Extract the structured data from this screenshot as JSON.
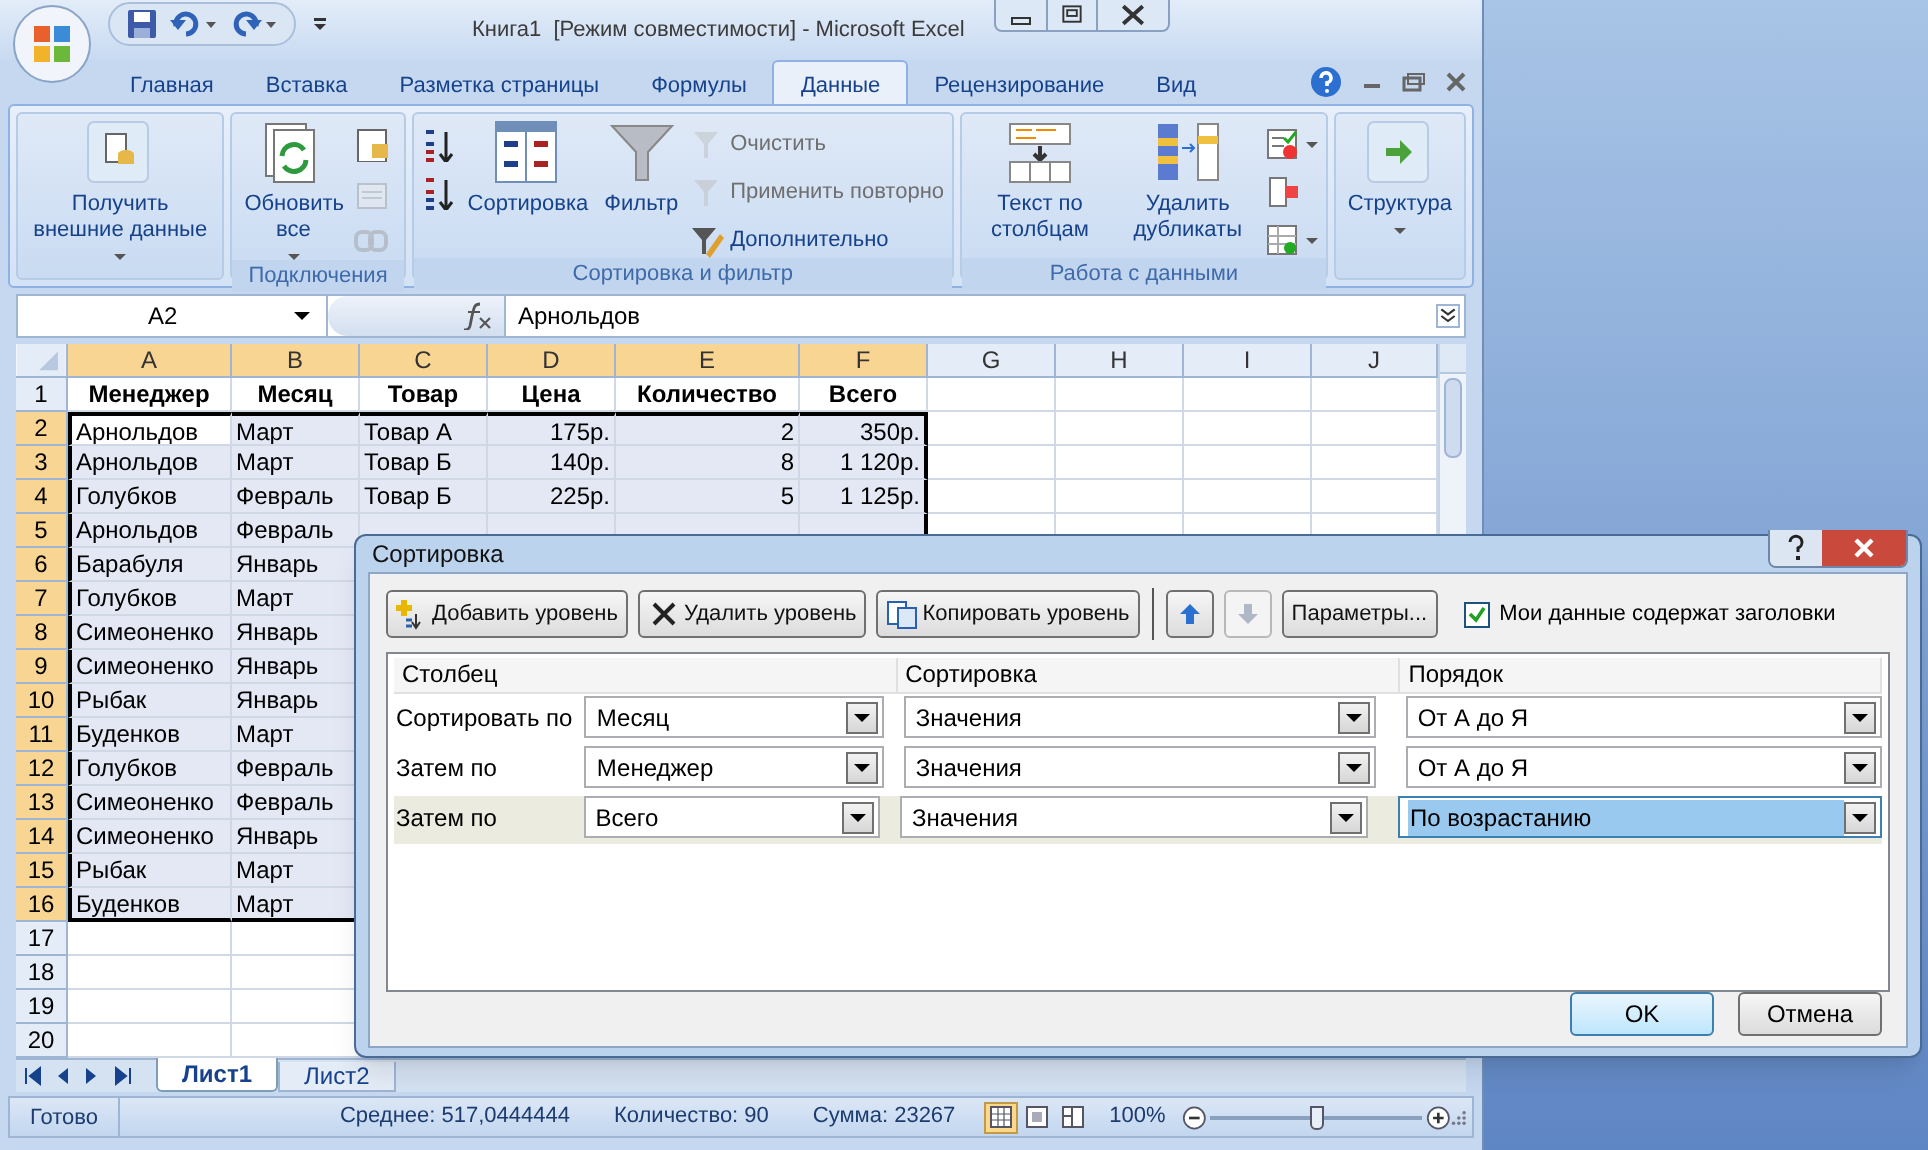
{
  "window": {
    "title": "Книга1  [Режим совместимости] - Microsoft Excel"
  },
  "ribbon_tabs": [
    {
      "label": "Главная",
      "selected": false
    },
    {
      "label": "Вставка",
      "selected": false
    },
    {
      "label": "Разметка страницы",
      "selected": false
    },
    {
      "label": "Формулы",
      "selected": false
    },
    {
      "label": "Данные",
      "selected": true
    },
    {
      "label": "Рецензирование",
      "selected": false
    },
    {
      "label": "Вид",
      "selected": false
    }
  ],
  "ribbon_groups": [
    {
      "items": [
        {
          "kind": "large",
          "label": "Получить внешние данные",
          "dropdown": true
        }
      ]
    },
    {
      "label": "Подключения",
      "items": [
        {
          "kind": "large",
          "label": "Обновить все",
          "dropdown": true
        },
        {
          "kind": "icon",
          "disabled": false
        },
        {
          "kind": "icon",
          "disabled": true
        },
        {
          "kind": "icon",
          "disabled": true
        }
      ]
    },
    {
      "label": "Сортировка и фильтр",
      "items": [
        {
          "kind": "icon",
          "disabled": false
        },
        {
          "kind": "icon",
          "disabled": false
        },
        {
          "kind": "large",
          "label": "Сортировка"
        },
        {
          "kind": "large",
          "label": "Фильтр"
        },
        {
          "kind": "small",
          "label": "Очистить",
          "disabled": true
        },
        {
          "kind": "small",
          "label": "Применить повторно",
          "disabled": true
        },
        {
          "kind": "small",
          "label": "Дополнительно",
          "disabled": false
        }
      ]
    },
    {
      "label": "Работа с данными",
      "items": [
        {
          "kind": "large",
          "label": "Текст по столбцам"
        },
        {
          "kind": "large",
          "label": "Удалить дубликаты"
        },
        {
          "kind": "icon",
          "disabled": false,
          "dropdown": true
        },
        {
          "kind": "icon",
          "disabled": false
        },
        {
          "kind": "icon",
          "disabled": false,
          "dropdown": true
        }
      ]
    },
    {
      "items": [
        {
          "kind": "large",
          "label": "Структура",
          "dropdown": true
        }
      ]
    }
  ],
  "formula_bar": {
    "name_box": "A2",
    "formula": "Арнольдов"
  },
  "sheet": {
    "columns": [
      {
        "label": "A",
        "selected": true,
        "kind": "text"
      },
      {
        "label": "B",
        "selected": true,
        "kind": "text"
      },
      {
        "label": "C",
        "selected": true,
        "kind": "text"
      },
      {
        "label": "D",
        "selected": true,
        "kind": "number"
      },
      {
        "label": "E",
        "selected": true,
        "kind": "number"
      },
      {
        "label": "F",
        "selected": true,
        "kind": "number"
      },
      {
        "label": "G",
        "selected": false
      },
      {
        "label": "H",
        "selected": false
      },
      {
        "label": "I",
        "selected": false
      },
      {
        "label": "J",
        "selected": false
      }
    ],
    "rows": [
      {
        "number": "1",
        "kind": "header",
        "selected": false,
        "cells": [
          "Менеджер",
          "Месяц",
          "Товар",
          "Цена",
          "Количество",
          "Всего"
        ]
      },
      {
        "number": "2",
        "kind": "data",
        "selected": true,
        "active": true,
        "cells": [
          "Арнольдов",
          "Март",
          "Товар А",
          "175р.",
          "2",
          "350р."
        ]
      },
      {
        "number": "3",
        "kind": "data",
        "selected": true,
        "cells": [
          "Арнольдов",
          "Март",
          "Товар Б",
          "140р.",
          "8",
          "1 120р."
        ]
      },
      {
        "number": "4",
        "kind": "data",
        "selected": true,
        "cells": [
          "Голубков",
          "Февраль",
          "Товар Б",
          "225р.",
          "5",
          "1 125р."
        ]
      },
      {
        "number": "5",
        "kind": "data",
        "selected": true,
        "cells": [
          "Арнольдов",
          "Февраль"
        ]
      },
      {
        "number": "6",
        "kind": "data",
        "selected": true,
        "cells": [
          "Барабуля",
          "Январь"
        ]
      },
      {
        "number": "7",
        "kind": "data",
        "selected": true,
        "cells": [
          "Голубков",
          "Март"
        ]
      },
      {
        "number": "8",
        "kind": "data",
        "selected": true,
        "cells": [
          "Симеоненко",
          "Январь"
        ]
      },
      {
        "number": "9",
        "kind": "data",
        "selected": true,
        "cells": [
          "Симеоненко",
          "Январь"
        ]
      },
      {
        "number": "10",
        "kind": "data",
        "selected": true,
        "cells": [
          "Рыбак",
          "Январь"
        ]
      },
      {
        "number": "11",
        "kind": "data",
        "selected": true,
        "cells": [
          "Буденков",
          "Март"
        ]
      },
      {
        "number": "12",
        "kind": "data",
        "selected": true,
        "cells": [
          "Голубков",
          "Февраль"
        ]
      },
      {
        "number": "13",
        "kind": "data",
        "selected": true,
        "cells": [
          "Симеоненко",
          "Февраль"
        ]
      },
      {
        "number": "14",
        "kind": "data",
        "selected": true,
        "cells": [
          "Симеоненко",
          "Январь"
        ]
      },
      {
        "number": "15",
        "kind": "data",
        "selected": true,
        "cells": [
          "Рыбак",
          "Март"
        ]
      },
      {
        "number": "16",
        "kind": "data",
        "selected": true,
        "cells": [
          "Буденков",
          "Март"
        ]
      },
      {
        "number": "17",
        "selected": false,
        "cells": []
      },
      {
        "number": "18",
        "selected": false,
        "cells": []
      },
      {
        "number": "19",
        "selected": false,
        "cells": []
      },
      {
        "number": "20",
        "selected": false,
        "cells": []
      }
    ]
  },
  "sheet_tabs": [
    {
      "label": "Лист1",
      "selected": true
    },
    {
      "label": "Лист2",
      "selected": false
    }
  ],
  "status_bar": {
    "state": "Готово",
    "stats": [
      "Среднее: 517,0444444",
      "Количество: 90",
      "Сумма: 23267"
    ],
    "views": [
      {
        "selected": true
      },
      {
        "selected": false
      },
      {
        "selected": false
      }
    ],
    "zoom": "100%",
    "zoom_level": {
      "level": 0.5
    }
  },
  "dialog": {
    "title": "Сортировка",
    "toolbar": [
      {
        "kind": "button",
        "label": "Добавить уровень"
      },
      {
        "kind": "button",
        "label": "Удалить уровень"
      },
      {
        "kind": "button",
        "label": "Копировать уровень"
      },
      {
        "kind": "up",
        "disabled": false
      },
      {
        "kind": "down",
        "disabled": true
      },
      {
        "kind": "button",
        "label": "Параметры..."
      }
    ],
    "headers_checkbox": {
      "label": "Мои данные содержат заголовки",
      "checked": true
    },
    "columns": [
      "Столбец",
      "Сортировка",
      "Порядок"
    ],
    "levels": [
      {
        "label": "Сортировать по",
        "column": "Месяц",
        "sort_on": "Значения",
        "order": "От А до Я",
        "selected": false
      },
      {
        "label": "Затем по",
        "column": "Менеджер",
        "sort_on": "Значения",
        "order": "От А до Я",
        "selected": false
      },
      {
        "label": "Затем по",
        "column": "Всего",
        "sort_on": "Значения",
        "order": "По возрастанию",
        "selected": true
      }
    ],
    "buttons": [
      {
        "label": "OK",
        "default": true
      },
      {
        "label": "Отмена",
        "default": false
      }
    ]
  }
}
